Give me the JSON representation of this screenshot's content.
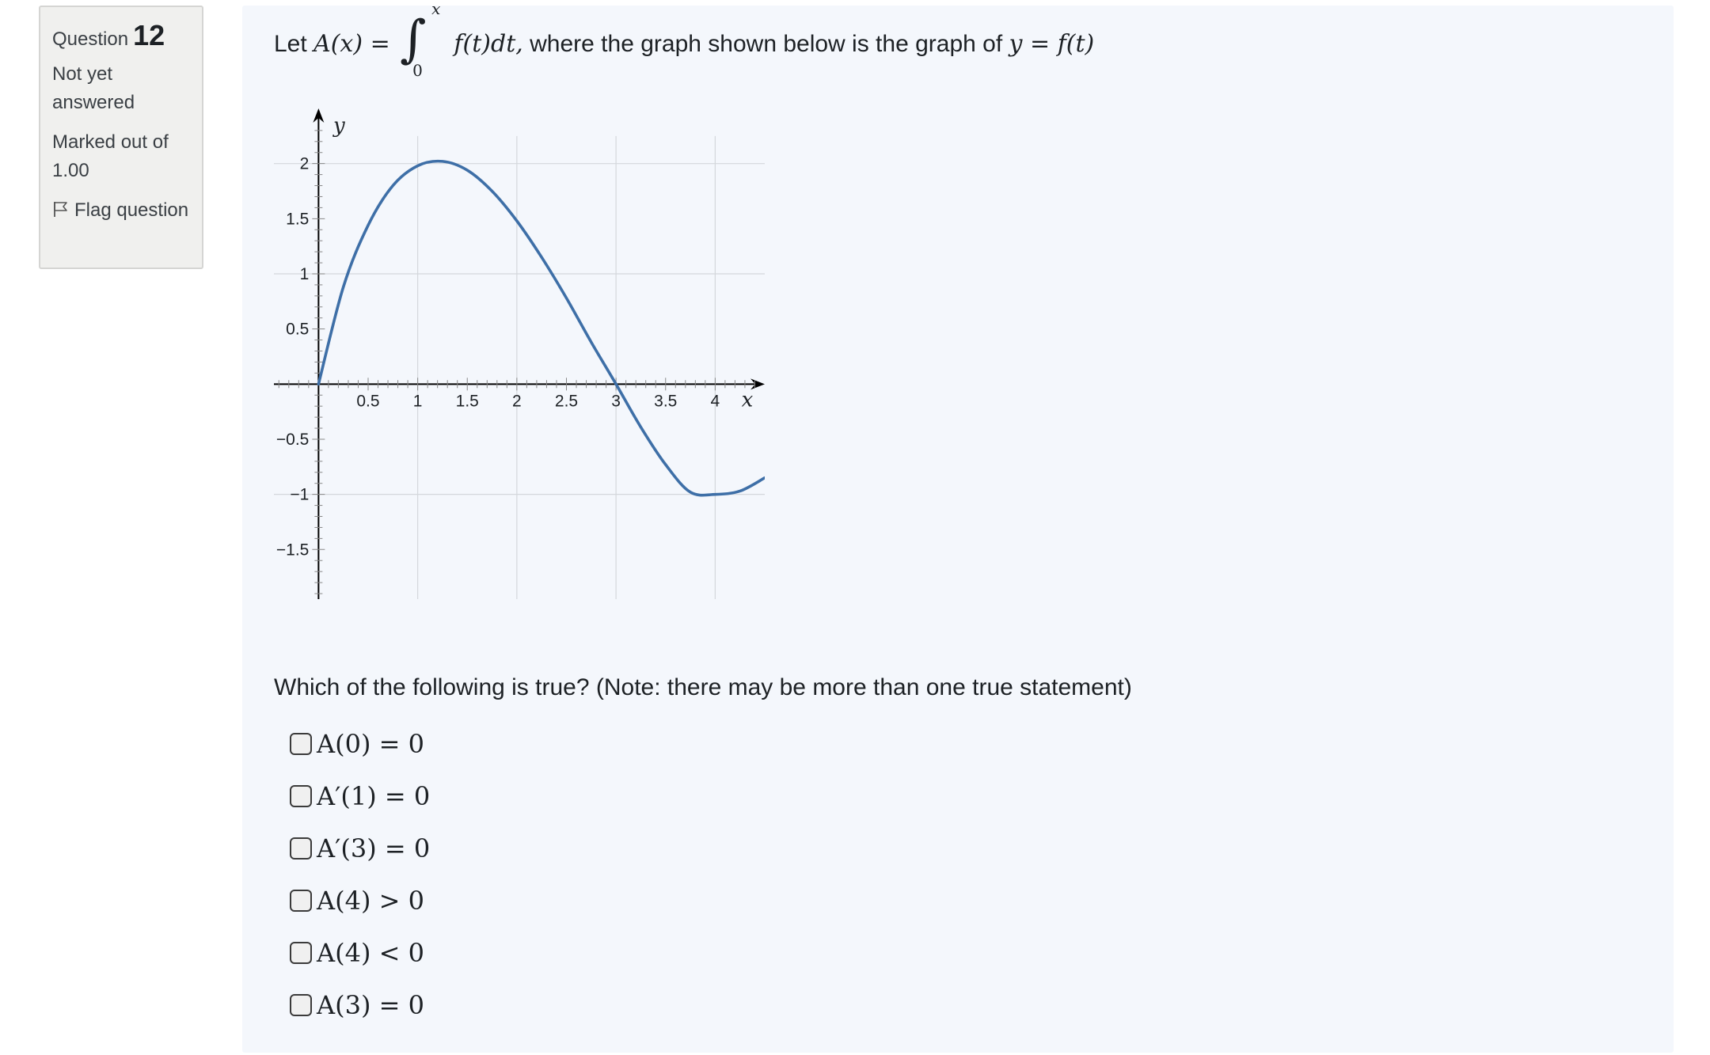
{
  "info": {
    "question_label": "Question",
    "question_number": "12",
    "state": "Not yet answered",
    "grade": "Marked out of 1.00",
    "flag_label": "Flag question"
  },
  "question": {
    "let": "Let",
    "A_of_x": "A(x) =",
    "upper_limit": "x",
    "lower_limit": "0",
    "integrand": "f(t)dt,",
    "middle_text": "where the graph shown below is the graph of",
    "y_eq": "y = f(t)"
  },
  "prompt": "Which of the following is true? (Note: there may be more than one true statement)",
  "options": [
    {
      "label": "A(0) = 0"
    },
    {
      "label": "A′(1) = 0"
    },
    {
      "label": "A′(3) = 0"
    },
    {
      "label": "A(4) > 0"
    },
    {
      "label": "A(4) < 0"
    },
    {
      "label": "A(3) = 0"
    }
  ],
  "chart_data": {
    "type": "line",
    "xlabel": "x",
    "ylabel": "y",
    "xlim": [
      -0.45,
      4.5
    ],
    "ylim": [
      -1.95,
      2.5
    ],
    "x_ticks": [
      0.5,
      1,
      1.5,
      2,
      2.5,
      3,
      3.5,
      4
    ],
    "x_tick_labels": [
      "0.5",
      "1",
      "1.5",
      "2",
      "2.5",
      "3",
      "3.5",
      "4"
    ],
    "y_ticks": [
      2,
      1.5,
      1,
      0.5,
      -0.5,
      -1,
      -1.5
    ],
    "y_tick_labels": [
      "2",
      "1.5",
      "1",
      "0.5",
      "−0.5",
      "−1",
      "−1.5"
    ],
    "grid": true,
    "series": [
      {
        "color": "#3e6fa7",
        "x": [
          0,
          0.25,
          0.5,
          0.75,
          1.0,
          1.25,
          1.5,
          1.75,
          2.0,
          2.25,
          2.5,
          2.75,
          3.0,
          3.25,
          3.5,
          3.75,
          4.0,
          4.25,
          4.5
        ],
        "y": [
          0,
          0.88,
          1.44,
          1.8,
          1.98,
          2.02,
          1.94,
          1.75,
          1.48,
          1.15,
          0.78,
          0.38,
          0,
          -0.39,
          -0.73,
          -0.98,
          -1.0,
          -0.97,
          -0.85
        ]
      }
    ]
  }
}
